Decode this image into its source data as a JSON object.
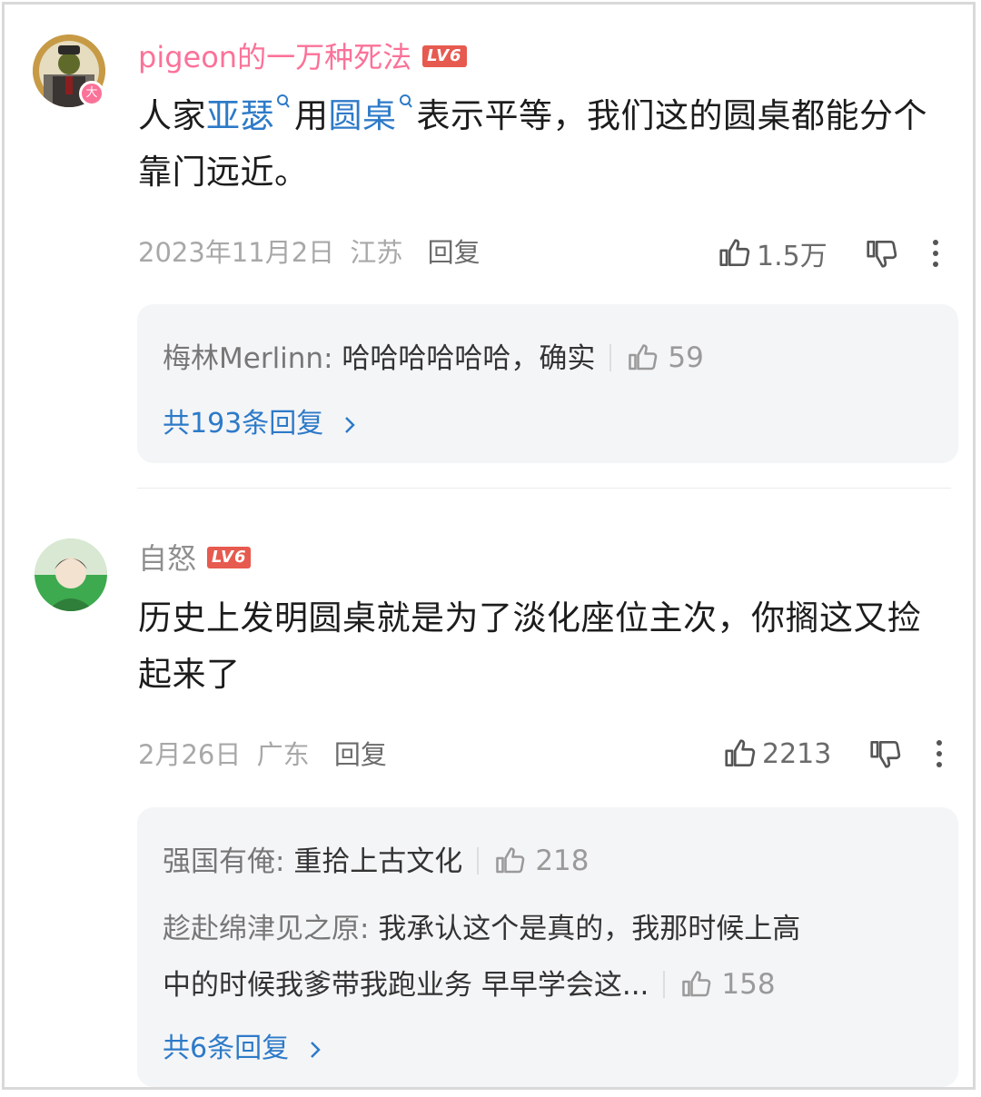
{
  "comments": [
    {
      "username": "pigeon的一万种死法",
      "level": "LV6",
      "content_parts": [
        "人家",
        "亚瑟",
        "用",
        "圆桌",
        "表示平等，我们这的圆桌都能分个靠门远近。"
      ],
      "date": "2023年11月2日",
      "location": "江苏",
      "reply_label": "回复",
      "likes": "1.5万",
      "replies": [
        {
          "name": "梅林Merlinn:",
          "text": "哈哈哈哈哈哈，确实",
          "likes": "59"
        }
      ],
      "more_replies": "共193条回复"
    },
    {
      "username": "自怒",
      "level": "LV6",
      "content": "历史上发明圆桌就是为了淡化座位主次，你搁这又捡起来了",
      "date": "2月26日",
      "location": "广东",
      "reply_label": "回复",
      "likes": "2213",
      "replies": [
        {
          "name": "强国有俺:",
          "text": "重拾上古文化",
          "likes": "218"
        },
        {
          "name": "趁赴绵津见之原:",
          "text_line1": "我承认这个是真的，我那时候上高",
          "text_line2": "中的时候我爹带我跑业务 早早学会这...",
          "likes": "158"
        }
      ],
      "more_replies": "共6条回复"
    }
  ],
  "colors": {
    "username_pink": "#fb7299",
    "username_gray": "#8f8f8f",
    "link_blue": "#2d7ac8",
    "level_red": "#e65a4f"
  },
  "icons": [
    "thumbs-up-icon",
    "thumbs-down-icon",
    "kebab-menu-icon",
    "search-icon",
    "chevron-right-icon"
  ]
}
